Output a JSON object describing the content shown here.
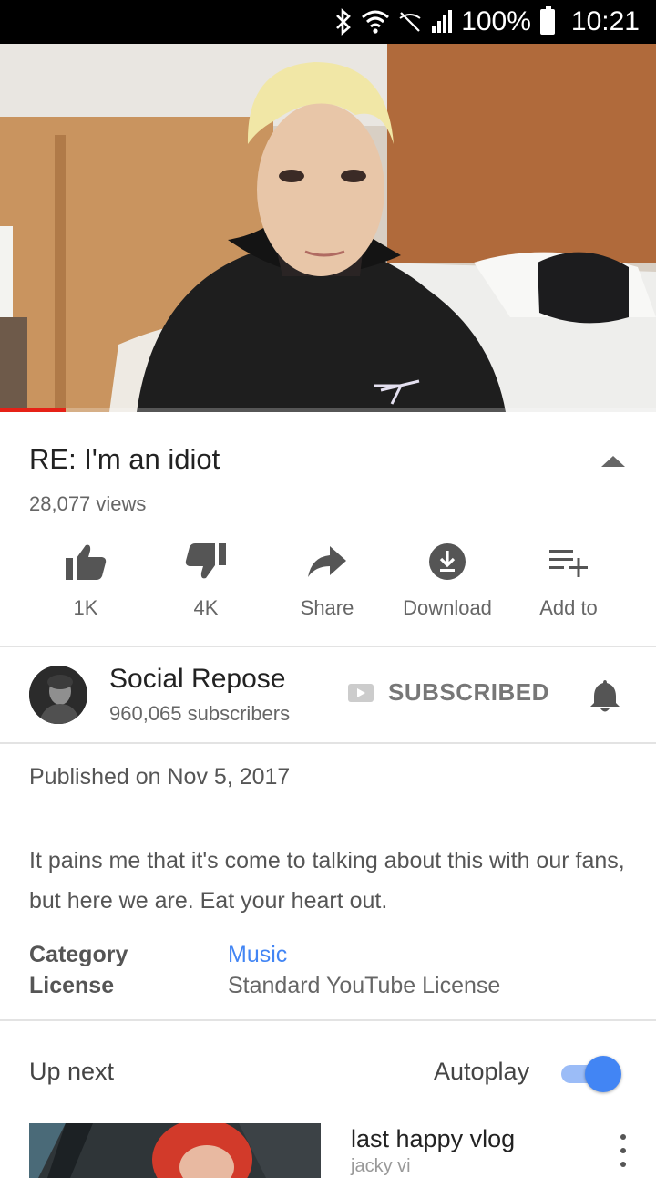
{
  "status_bar": {
    "battery": "100%",
    "time": "10:21",
    "icons": [
      "bluetooth-icon",
      "wifi-icon",
      "mute-icon",
      "signal-icon",
      "battery-icon"
    ]
  },
  "video": {
    "title": "RE: I'm an idiot",
    "views": "28,077 views",
    "progress": 0.1
  },
  "actions": [
    {
      "label": "1K",
      "icon": "thumbs-up-icon"
    },
    {
      "label": "4K",
      "icon": "thumbs-down-icon"
    },
    {
      "label": "Share",
      "icon": "share-icon"
    },
    {
      "label": "Download",
      "icon": "download-icon"
    },
    {
      "label": "Add to",
      "icon": "add-to-playlist-icon"
    }
  ],
  "channel": {
    "name": "Social Repose",
    "subscribers": "960,065 subscribers",
    "subscribe_label": "SUBSCRIBED"
  },
  "description": {
    "published": "Published on Nov 5, 2017",
    "text": "It pains me that it's come to talking about this with our fans, but here we are. Eat your heart out.",
    "category_label": "Category",
    "category_value": "Music",
    "license_label": "License",
    "license_value": "Standard YouTube License"
  },
  "up_next": {
    "label": "Up next",
    "autoplay_label": "Autoplay",
    "autoplay_on": true,
    "next_video_title": "last happy vlog",
    "next_video_channel": "jacky vi"
  },
  "colors": {
    "accent_blue": "#4285f4",
    "progress_red": "#e62117"
  }
}
